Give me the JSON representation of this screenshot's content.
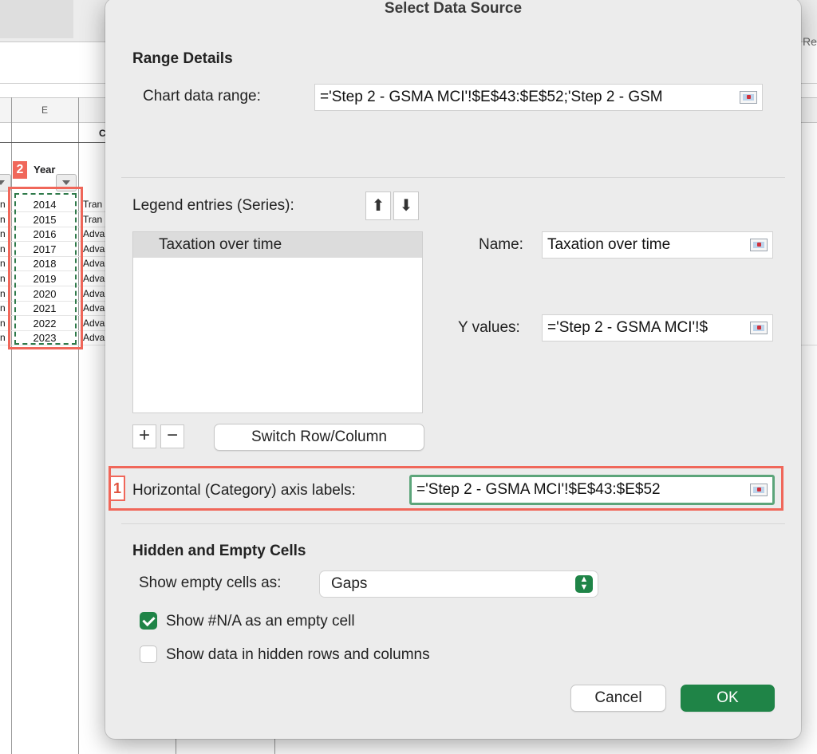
{
  "spreadsheet": {
    "column_letter": "E",
    "year_header": "Year",
    "years": [
      "2014",
      "2015",
      "2016",
      "2017",
      "2018",
      "2019",
      "2020",
      "2021",
      "2022",
      "2023"
    ],
    "left_cells": [
      "n",
      "n",
      "n",
      "n",
      "n",
      "n",
      "n",
      "n",
      "n",
      "n"
    ],
    "right_cells": [
      "Tran",
      "Tran",
      "Adva",
      "Adva",
      "Adva",
      "Adva",
      "Adva",
      "Adva",
      "Adva",
      "Adva"
    ],
    "cut_header": "C",
    "cut_right_text": "Re",
    "callout_2": "2"
  },
  "dialog": {
    "title": "Select Data Source",
    "range_details": {
      "heading": "Range Details",
      "chart_data_range_label": "Chart data range:",
      "chart_data_range_value": "='Step 2 - GSMA MCI'!$E$43:$E$52;'Step 2 - GSM"
    },
    "legend": {
      "label": "Legend entries (Series):",
      "up_arrow": "⬆",
      "down_arrow": "⬇",
      "series": [
        "Taxation over time"
      ],
      "add": "+",
      "remove": "−",
      "switch_button": "Switch Row/Column"
    },
    "series_details": {
      "name_label": "Name:",
      "name_value": "Taxation over time",
      "y_values_label": "Y values:",
      "y_values_value": "='Step 2 - GSMA MCI'!$"
    },
    "category_axis": {
      "callout": "1",
      "label": "Horizontal (Category) axis labels:",
      "value": "='Step 2 - GSMA MCI'!$E$43:$E$52"
    },
    "hidden_empty": {
      "heading": "Hidden and Empty Cells",
      "show_empty_label": "Show empty cells as:",
      "show_empty_value": "Gaps",
      "chevron": "⌃⌄",
      "na_checkbox_label": "Show #N/A as an empty cell",
      "na_checked": true,
      "hidden_checkbox_label": "Show data in hidden rows and columns",
      "hidden_checked": false
    },
    "buttons": {
      "cancel": "Cancel",
      "ok": "OK"
    }
  }
}
